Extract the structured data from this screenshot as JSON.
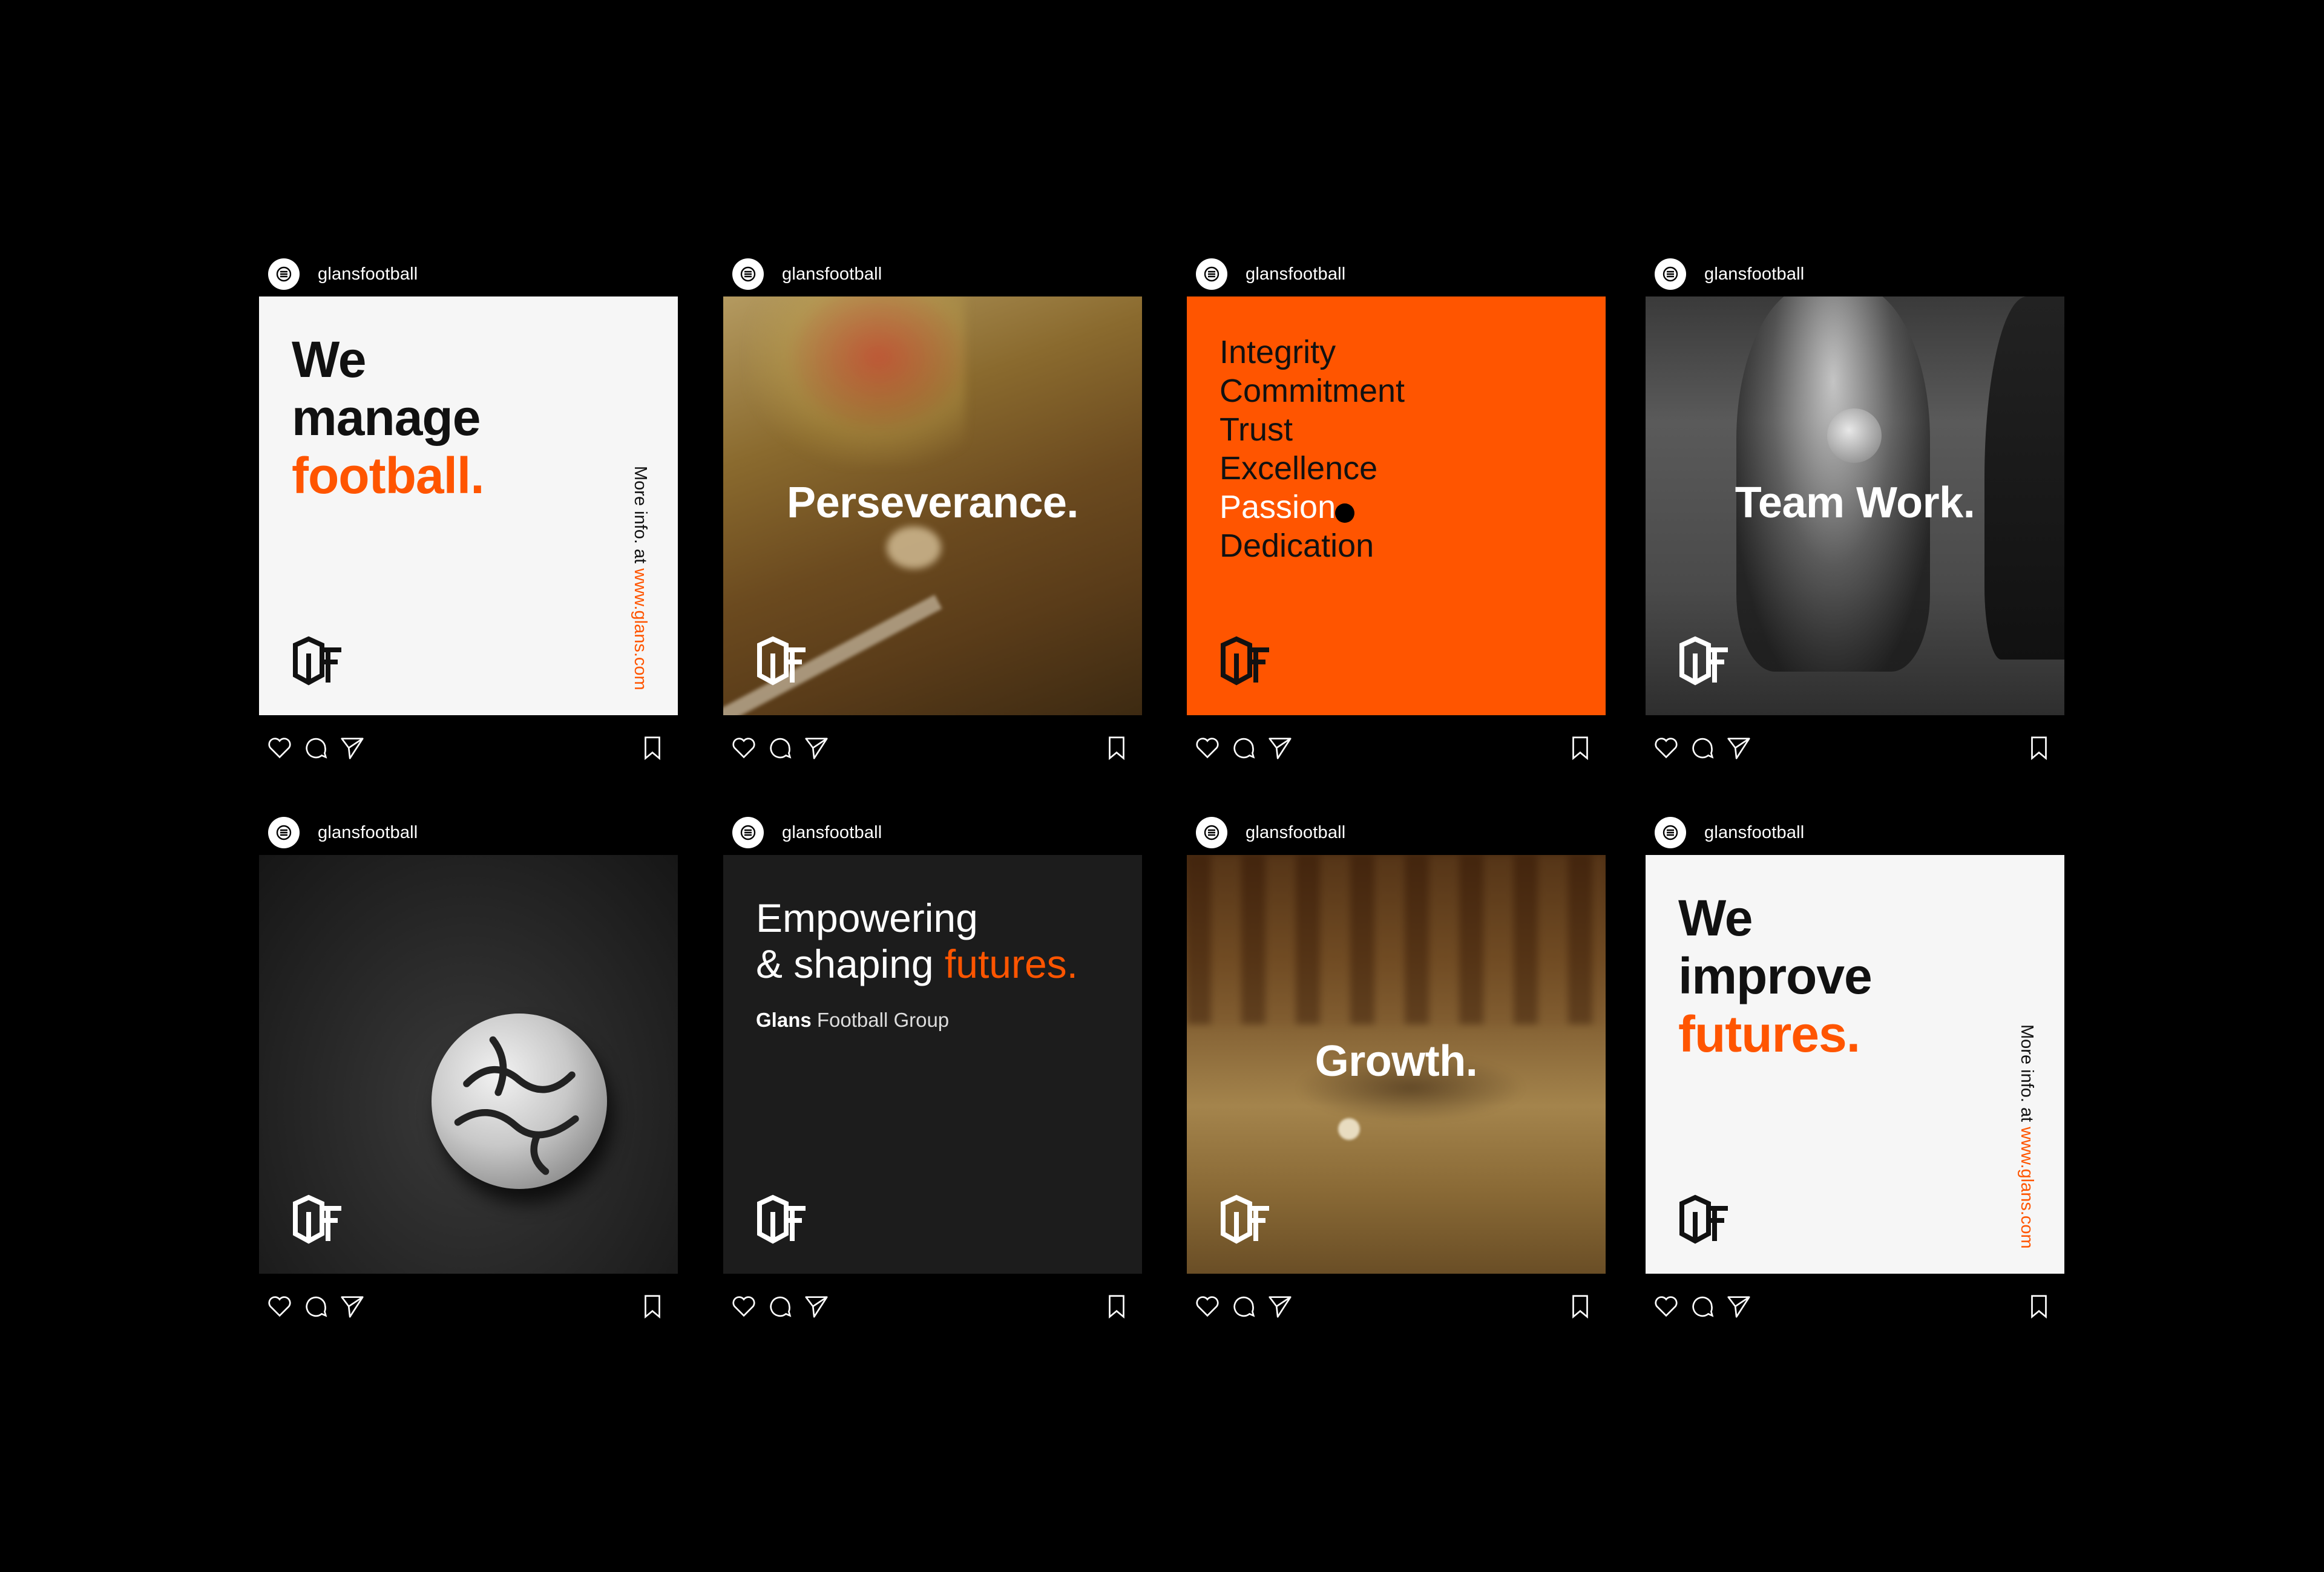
{
  "account": {
    "username": "glansfootball"
  },
  "posts": [
    {
      "kind": "text",
      "lines": [
        "We",
        "manage"
      ],
      "accent": "football.",
      "side_prefix": "More info. at ",
      "side_link": "www.glans.com"
    },
    {
      "kind": "photo",
      "caption": "Perseverance."
    },
    {
      "kind": "values",
      "values": [
        "Integrity",
        "Commitment",
        "Trust",
        "Excellence",
        "Passion",
        "Dedication"
      ]
    },
    {
      "kind": "photo",
      "caption": "Team Work."
    },
    {
      "kind": "photo",
      "caption": ""
    },
    {
      "kind": "statement",
      "line1": "Empowering",
      "line2": "& shaping",
      "accent": "futures.",
      "brand": "Glans",
      "group": " Football Group"
    },
    {
      "kind": "photo",
      "caption": "Growth."
    },
    {
      "kind": "text",
      "lines": [
        "We",
        "improve"
      ],
      "accent": "futures.",
      "side_prefix": "More info. at ",
      "side_link": "www.glans.com"
    }
  ],
  "icons": [
    "heart-icon",
    "comment-icon",
    "send-icon",
    "bookmark-icon"
  ],
  "colors": {
    "accent": "#ff5500",
    "background": "#000000",
    "light_card": "#f6f6f6",
    "dark_card": "#1c1c1c"
  }
}
